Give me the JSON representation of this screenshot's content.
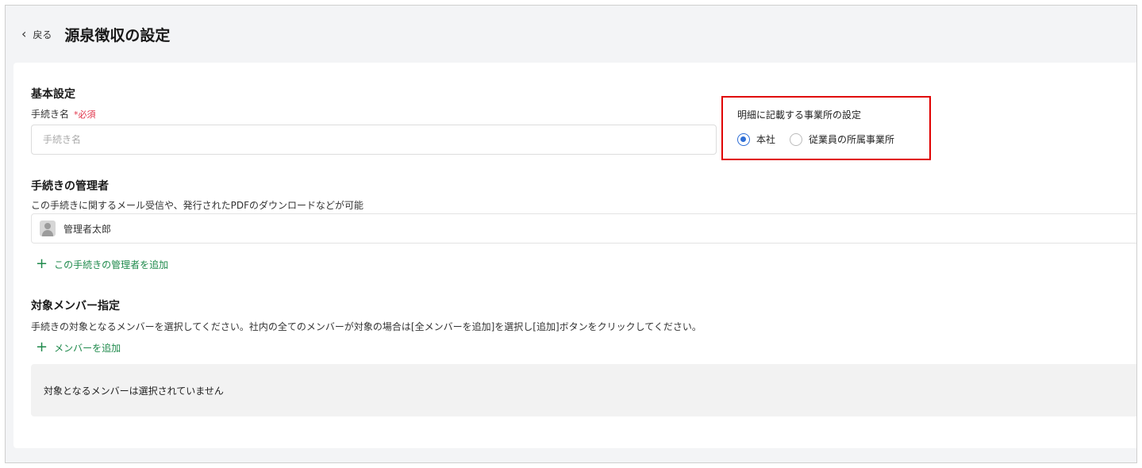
{
  "header": {
    "back_label": "戻る",
    "title": "源泉徴収の設定"
  },
  "basic": {
    "heading": "基本設定",
    "name_label": "手続き名",
    "required_mark": "*必須",
    "name_value": "",
    "name_placeholder": "手続き名"
  },
  "office": {
    "title": "明細に記載する事業所の設定",
    "options": [
      {
        "label": "本社",
        "selected": true
      },
      {
        "label": "従業員の所属事業所",
        "selected": false
      }
    ]
  },
  "managers": {
    "heading": "手続きの管理者",
    "description": "この手続きに関するメール受信や、発行されたPDFのダウンロードなどが可能",
    "items": [
      {
        "name": "管理者太郎"
      }
    ],
    "add_label": "この手続きの管理者を追加"
  },
  "members": {
    "heading": "対象メンバー指定",
    "description": "手続きの対象となるメンバーを選択してください。社内の全てのメンバーが対象の場合は[全メンバーを追加]を選択し[追加]ボタンをクリックしてください。",
    "add_label": "メンバーを追加",
    "empty_text": "対象となるメンバーは選択されていません"
  },
  "colors": {
    "accent_green": "#1f8a4c",
    "radio_blue": "#2f6fd6",
    "required_red": "#e0344a",
    "highlight_red": "#e00000"
  }
}
